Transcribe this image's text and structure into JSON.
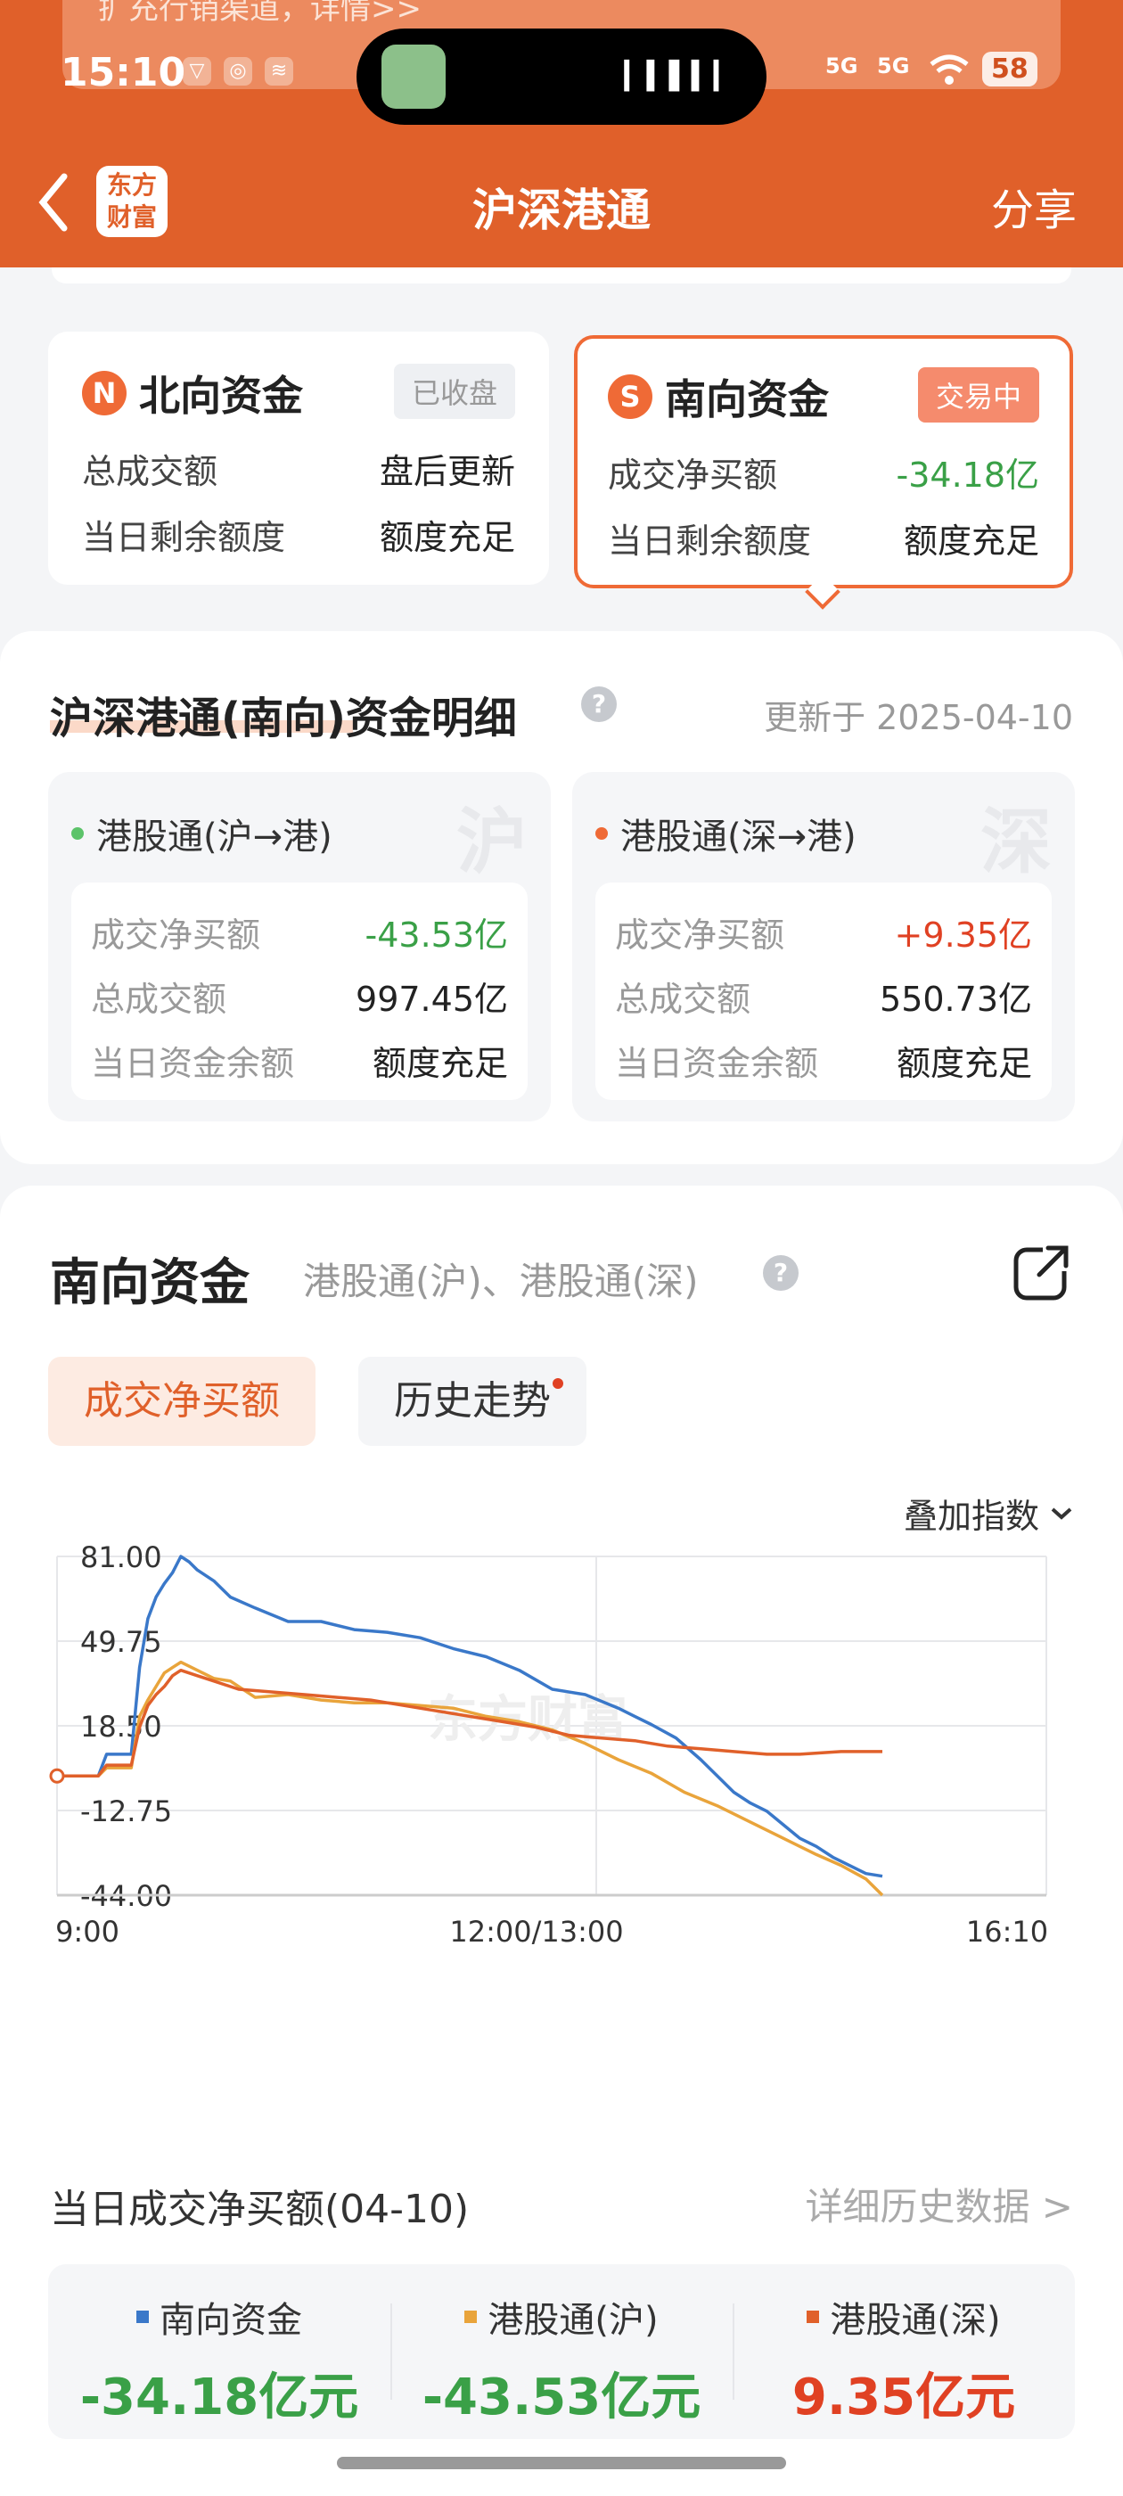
{
  "status_bar": {
    "time": "15:10",
    "battery": "58",
    "signal1": "5G",
    "signal2": "5G"
  },
  "notification": {
    "text": "扩充行销渠道，详情>>"
  },
  "nav": {
    "title": "沪深港通",
    "share": "分享",
    "logo": "东方财富",
    "back_icon": "chevron-left-icon"
  },
  "north_card": {
    "badge": "N",
    "title": "北向资金",
    "status": "已收盘",
    "rows": [
      {
        "label": "总成交额",
        "value": "盘后更新"
      },
      {
        "label": "当日剩余额度",
        "value": "额度充足"
      }
    ]
  },
  "south_card": {
    "badge": "S",
    "title": "南向资金",
    "status": "交易中",
    "rows": [
      {
        "label": "成交净买额",
        "value": "-34.18亿"
      },
      {
        "label": "当日剩余额度",
        "value": "额度充足"
      }
    ]
  },
  "detail": {
    "title": "沪深港通(南向)资金明细",
    "updated": "更新于 2025-04-10",
    "help": "?",
    "panels": [
      {
        "name": "港股通(沪→港)",
        "watermark": "沪",
        "dot_color": "#5cc36a",
        "rows": [
          {
            "label": "成交净买额",
            "value": "-43.53亿"
          },
          {
            "label": "总成交额",
            "value": "997.45亿"
          },
          {
            "label": "当日资金余额",
            "value": "额度充足"
          }
        ]
      },
      {
        "name": "港股通(深→港)",
        "watermark": "深",
        "dot_color": "#ef6a36",
        "rows": [
          {
            "label": "成交净买额",
            "value": "+9.35亿"
          },
          {
            "label": "总成交额",
            "value": "550.73亿"
          },
          {
            "label": "当日资金余额",
            "value": "额度充足"
          }
        ]
      }
    ]
  },
  "chart_section": {
    "title": "南向资金",
    "subtitle": "港股通(沪)、港股通(深)",
    "help": "?",
    "tabs": [
      {
        "label": "成交净买额",
        "active": true
      },
      {
        "label": "历史走势",
        "active": false
      }
    ],
    "overlay_label": "叠加指数",
    "watermark": "东方财富"
  },
  "chart_data": {
    "type": "line",
    "x_ticks": [
      "9:00",
      "12:00/13:00",
      "16:10"
    ],
    "y_ticks": [
      "81.00",
      "49.75",
      "18.50",
      "-12.75",
      "-44.00"
    ],
    "ylim": [
      -44.0,
      81.0
    ],
    "grid": true,
    "series": [
      {
        "name": "南向资金",
        "color": "#3a78c9",
        "points": [
          [
            0,
            0
          ],
          [
            0.05,
            0
          ],
          [
            0.06,
            8
          ],
          [
            0.07,
            8
          ],
          [
            0.09,
            8
          ],
          [
            0.1,
            40
          ],
          [
            0.11,
            58
          ],
          [
            0.12,
            66
          ],
          [
            0.13,
            71
          ],
          [
            0.14,
            75
          ],
          [
            0.15,
            81
          ],
          [
            0.16,
            79
          ],
          [
            0.17,
            76
          ],
          [
            0.19,
            72
          ],
          [
            0.21,
            66
          ],
          [
            0.24,
            62
          ],
          [
            0.28,
            57
          ],
          [
            0.32,
            57
          ],
          [
            0.36,
            54
          ],
          [
            0.4,
            53
          ],
          [
            0.44,
            51
          ],
          [
            0.48,
            47
          ],
          [
            0.52,
            44
          ],
          [
            0.56,
            39
          ],
          [
            0.6,
            32
          ],
          [
            0.64,
            30
          ],
          [
            0.68,
            25
          ],
          [
            0.7,
            22
          ],
          [
            0.72,
            19
          ],
          [
            0.75,
            14
          ],
          [
            0.78,
            6
          ],
          [
            0.8,
            0
          ],
          [
            0.82,
            -6
          ],
          [
            0.84,
            -10
          ],
          [
            0.86,
            -13
          ],
          [
            0.88,
            -18
          ],
          [
            0.9,
            -23
          ],
          [
            0.92,
            -26
          ],
          [
            0.94,
            -30
          ],
          [
            0.96,
            -33
          ],
          [
            0.98,
            -36
          ],
          [
            1.0,
            -37
          ]
        ]
      },
      {
        "name": "港股通(沪)",
        "color": "#e9a43b",
        "points": [
          [
            0,
            0
          ],
          [
            0.05,
            0
          ],
          [
            0.06,
            3
          ],
          [
            0.09,
            3
          ],
          [
            0.1,
            22
          ],
          [
            0.11,
            28
          ],
          [
            0.12,
            33
          ],
          [
            0.13,
            38
          ],
          [
            0.14,
            40
          ],
          [
            0.15,
            42
          ],
          [
            0.17,
            39
          ],
          [
            0.19,
            36
          ],
          [
            0.21,
            35
          ],
          [
            0.24,
            29
          ],
          [
            0.28,
            30
          ],
          [
            0.32,
            28
          ],
          [
            0.36,
            27
          ],
          [
            0.4,
            27
          ],
          [
            0.44,
            26
          ],
          [
            0.48,
            25
          ],
          [
            0.52,
            22
          ],
          [
            0.56,
            20
          ],
          [
            0.6,
            17
          ],
          [
            0.64,
            12
          ],
          [
            0.68,
            6
          ],
          [
            0.72,
            1
          ],
          [
            0.76,
            -6
          ],
          [
            0.8,
            -11
          ],
          [
            0.84,
            -17
          ],
          [
            0.88,
            -23
          ],
          [
            0.92,
            -29
          ],
          [
            0.95,
            -33
          ],
          [
            0.98,
            -38
          ],
          [
            1.0,
            -44
          ]
        ]
      },
      {
        "name": "港股通(深)",
        "color": "#e0602a",
        "points": [
          [
            0,
            0
          ],
          [
            0.05,
            0
          ],
          [
            0.06,
            4
          ],
          [
            0.09,
            4
          ],
          [
            0.1,
            18
          ],
          [
            0.11,
            26
          ],
          [
            0.12,
            30
          ],
          [
            0.13,
            33
          ],
          [
            0.14,
            37
          ],
          [
            0.15,
            39
          ],
          [
            0.17,
            37
          ],
          [
            0.19,
            35
          ],
          [
            0.22,
            32
          ],
          [
            0.26,
            31
          ],
          [
            0.3,
            30
          ],
          [
            0.34,
            29
          ],
          [
            0.38,
            28
          ],
          [
            0.42,
            26
          ],
          [
            0.46,
            24
          ],
          [
            0.5,
            22
          ],
          [
            0.54,
            20
          ],
          [
            0.58,
            18
          ],
          [
            0.62,
            15
          ],
          [
            0.66,
            14
          ],
          [
            0.7,
            13
          ],
          [
            0.74,
            11
          ],
          [
            0.78,
            10
          ],
          [
            0.82,
            9
          ],
          [
            0.86,
            8
          ],
          [
            0.9,
            8
          ],
          [
            0.95,
            9
          ],
          [
            1.0,
            9
          ]
        ]
      }
    ]
  },
  "today": {
    "title": "当日成交净买额(04-10)",
    "link": "详细历史数据 >",
    "items": [
      {
        "name": "南向资金",
        "value": "-34.18亿元",
        "color": "#3a78c9"
      },
      {
        "name": "港股通(沪)",
        "value": "-43.53亿元",
        "color": "#e9a43b"
      },
      {
        "name": "港股通(深)",
        "value": "9.35亿元",
        "color": "#e0602a"
      }
    ]
  }
}
